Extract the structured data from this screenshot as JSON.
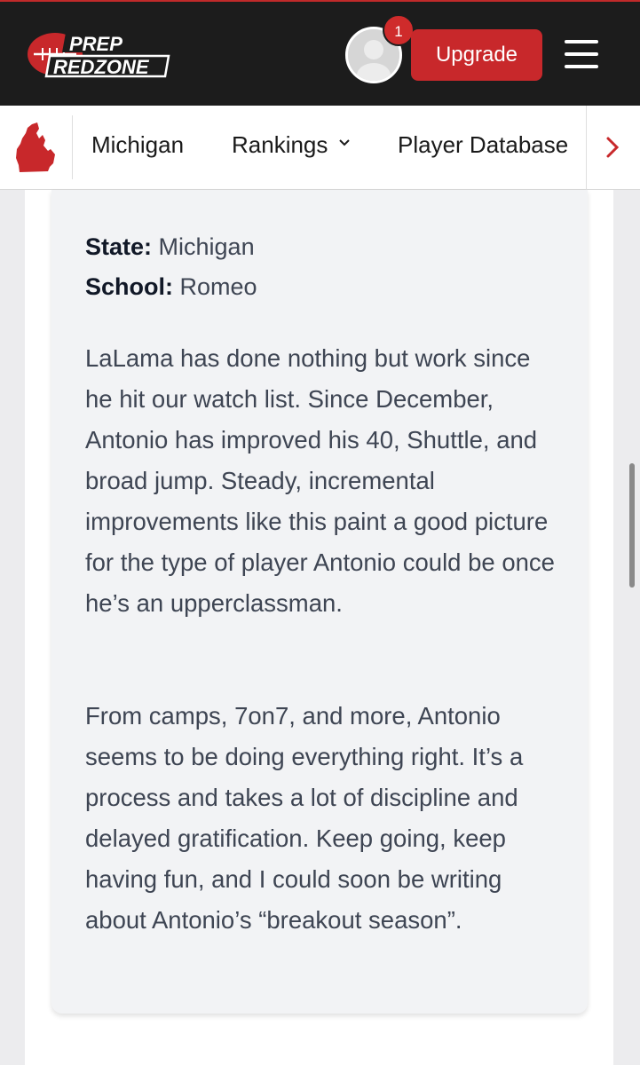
{
  "header": {
    "logo_line1": "PREP",
    "logo_line2": "REDZONE",
    "notification_count": "1",
    "upgrade_label": "Upgrade",
    "icons": [
      "avatar",
      "menu-icon"
    ]
  },
  "subnav": {
    "state_icon": "michigan-state-icon",
    "items": [
      {
        "label": "Michigan"
      },
      {
        "label": "Rankings"
      },
      {
        "label": "Player Database"
      }
    ],
    "rankings_chevron": "⌄",
    "more_icon": "chevron-right-icon"
  },
  "profile": {
    "state_label": "State:",
    "state_value": "Michigan",
    "school_label": "School:",
    "school_value": "Romeo"
  },
  "article": {
    "paragraphs": [
      "LaLama has done nothing but work since he hit our watch list. Since December, Antonio has improved his 40, Shuttle, and broad jump. Steady, incremental improvements like this paint a good picture for the type of player Antonio could be once he’s an upperclassman.",
      "From camps, 7on7, and more, Antonio seems to be doing everything right. It’s a process and takes a lot of discipline and delayed gratification. Keep going, keep having fun, and I could soon be writing about Antonio’s “breakout season”."
    ]
  },
  "colors": {
    "header_bg": "#1c1c1c",
    "brand_red": "#c8282b",
    "card_bg": "#f2f3f5",
    "text": "#3e4553"
  }
}
